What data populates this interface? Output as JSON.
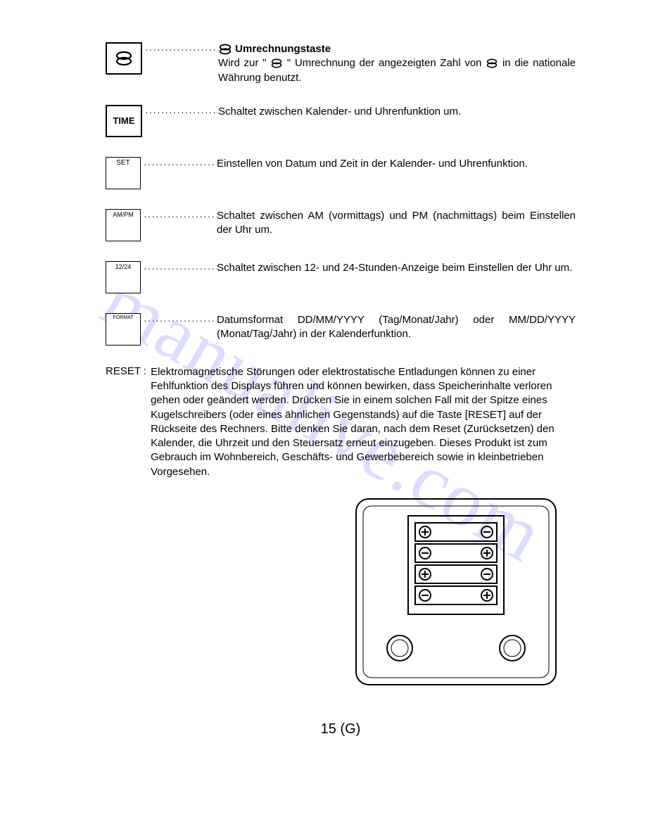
{
  "watermark": "manualive.com",
  "dots": "····················",
  "rows": [
    {
      "key": "coin",
      "title": "Umrechnungstaste",
      "desc": "Wird zur \"   \" Umrechnung der angezeigten Zahl von   in die nationale Währung benutzt."
    },
    {
      "key": "TIME",
      "desc": "Schaltet zwischen Kalender- und Uhrenfunktion um."
    },
    {
      "key": "SET",
      "desc": "Einstellen von Datum und Zeit in der Kalender- und Uhrenfunktion."
    },
    {
      "key": "AM/PM",
      "desc": "Schaltet zwischen AM (vormittags) und PM (nachmittags) beim Einstellen der Uhr um."
    },
    {
      "key": "12/24",
      "desc": "Schaltet zwischen 12- und 24-Stunden-Anzeige beim Einstellen der Uhr um."
    },
    {
      "key": "FORMAT",
      "desc": "Datumsformat DD/MM/YYYY (Tag/Monat/Jahr) oder MM/DD/YYYY (Monat/Tag/Jahr) in der Kalenderfunktion."
    }
  ],
  "reset": {
    "label": "RESET :",
    "text": "Elektromagnetische Störungen oder elektrostatische Entladungen können zu einer Fehlfunktion des Displays führen und können bewirken, dass Speicherinhalte verloren gehen oder geändert werden. Drücken Sie in einem solchen Fall mit der Spitze eines Kugelschreibers (oder eines ähnlichen Gegenstands) auf die Taste [RESET] auf der Rückseite des Rechners. Bitte denken Sie daran, nach dem Reset (Zurücksetzen) den Kalender, die Uhrzeit und den Steuersatz erneut einzugeben. Dieses Produkt ist zum Gebrauch im Wohnbereich, Geschäfts- und Gewerbebereich sowie in kleinbetrieben Vorgesehen."
  },
  "page_number": "15 (G)"
}
